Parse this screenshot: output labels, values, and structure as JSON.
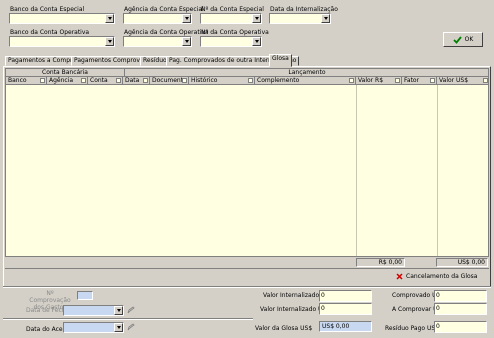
{
  "filters": {
    "banco_especial_label": "Banco da Conta Especial",
    "agencia_especial_label": "Agência da Conta Especial",
    "conta_especial_label": "Nº da Conta Especial",
    "data_internalizacao_label": "Data da Internalização",
    "banco_operativa_label": "Banco da Conta Operativa",
    "agencia_operativa_label": "Agência da Conta Operativa",
    "conta_operativa_label": "Nº da Conta Operativa"
  },
  "ok_button": {
    "label": "OK",
    "icon": "checkmark-icon",
    "icon_color": "#008000"
  },
  "tabs": [
    {
      "label": "Pagamentos a Comprovar",
      "active": false
    },
    {
      "label": "Pagamentos Comprovados",
      "active": false
    },
    {
      "label": "Resíduo",
      "active": false
    },
    {
      "label": "Pag. Comprovados de outra Internalização",
      "active": false
    },
    {
      "label": "Glosa",
      "active": true
    }
  ],
  "grid": {
    "group_conta_bancaria": "Conta Bancária",
    "group_lancamento": "Lançamento",
    "columns": [
      "Banco",
      "Agência",
      "Conta",
      "Data",
      "Documento",
      "Histórico",
      "Complemento",
      "Valor R$",
      "Fator",
      "Valor US$"
    ],
    "rows": [],
    "total_brl": "R$ 0,00",
    "total_usd": "US$ 0,00",
    "background": "#ffffe1"
  },
  "cancel_glosa_button": {
    "label": "Cancelamento da Glosa",
    "icon": "red-x-icon",
    "icon_color": "#d00000"
  },
  "bottom": {
    "n_comprovacao_label": "Nº Comprovação dos Gastos",
    "data_fechamento_label": "Data de Fechamento",
    "data_aceite_label": "Data do Aceite",
    "valor_internalizado_brl_label": "Valor Internalizado R$",
    "valor_internalizado_brl_value": "0",
    "valor_internalizado_usd_label": "Valor Internalizado US$",
    "valor_internalizado_usd_value": "0",
    "valor_glosa_label": "Valor da Glosa US$",
    "valor_glosa_value": "US$ 0,00",
    "comprovado_label": "Comprovado US$",
    "comprovado_value": "0",
    "a_comprovar_label": "A Comprovar US$",
    "a_comprovar_value": "0",
    "residuo_label": "Resíduo Pago US$",
    "residuo_value": "0"
  }
}
